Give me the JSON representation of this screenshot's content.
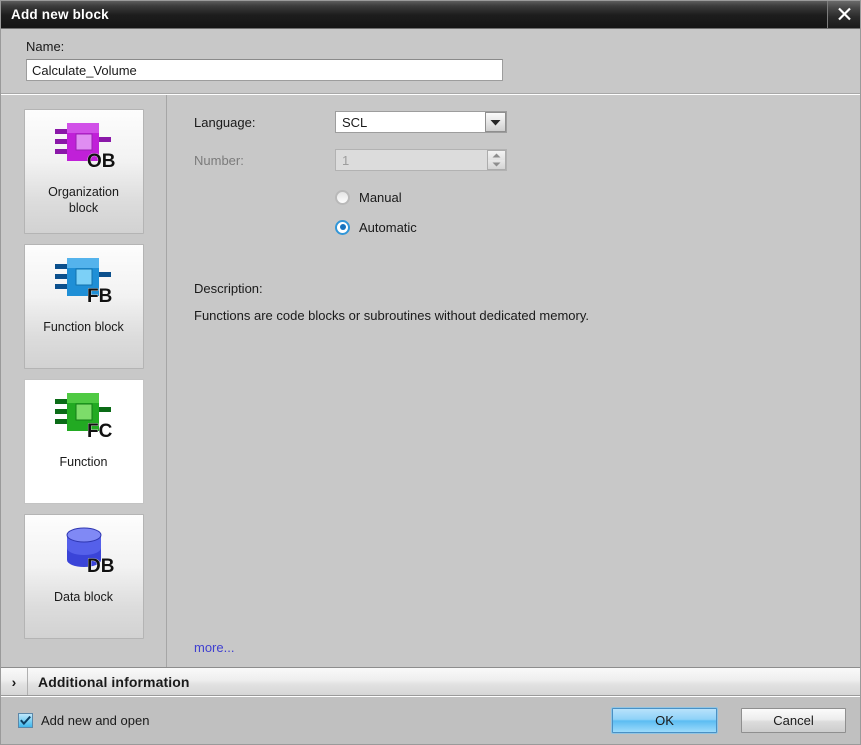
{
  "window": {
    "title": "Add new block",
    "close_icon": "close-icon"
  },
  "name_field": {
    "label": "Name:",
    "value": "Calculate_Volume",
    "placeholder": ""
  },
  "block_types": [
    {
      "id": "organization-block",
      "caption": "Organization\nblock",
      "caption_line1": "Organization",
      "caption_line2": "block",
      "abbr": "OB",
      "color": "#c020d8",
      "selected": false
    },
    {
      "id": "function-block",
      "caption": "Function block",
      "caption_line1": "Function block",
      "caption_line2": "",
      "abbr": "FB",
      "color": "#1f8fd6",
      "selected": false
    },
    {
      "id": "function",
      "caption": "Function",
      "caption_line1": "Function",
      "caption_line2": "",
      "abbr": "FC",
      "color": "#22aa22",
      "selected": true
    },
    {
      "id": "data-block",
      "caption": "Data block",
      "caption_line1": "Data block",
      "caption_line2": "",
      "abbr": "DB",
      "color": "#4a52e0",
      "selected": false
    }
  ],
  "detail": {
    "language_label": "Language:",
    "language_value": "SCL",
    "language_options": [
      "SCL"
    ],
    "number_label": "Number:",
    "number_value": "1",
    "number_enabled": false,
    "manual_label": "Manual",
    "manual_selected": false,
    "automatic_label": "Automatic",
    "automatic_selected": true,
    "description_label": "Description:",
    "description_text": "Functions are code blocks or subroutines without dedicated memory.",
    "more_link": "more...",
    "link_color": "#3f3fd0"
  },
  "additional_information": {
    "label": "Additional  information",
    "chevron": "chevron-right-icon",
    "expanded": false
  },
  "footer": {
    "checkbox_label": "Add new and open",
    "checkbox_checked": true,
    "ok_label": "OK",
    "cancel_label": "Cancel",
    "ok_accent": "#5cbdf2"
  }
}
